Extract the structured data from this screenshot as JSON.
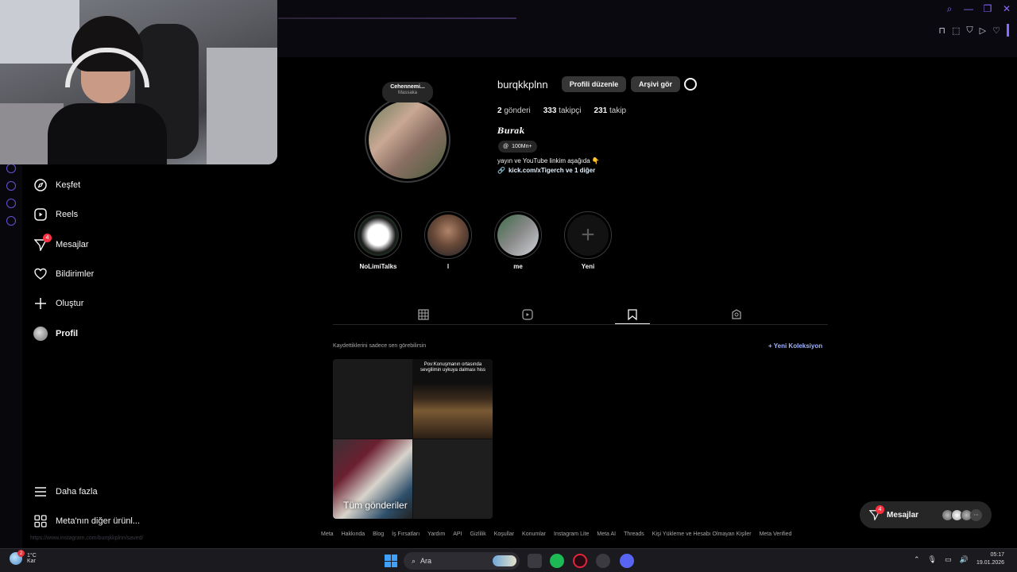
{
  "colors": {
    "bg": "#000000",
    "accent_gx": "#8a6bff",
    "badge": "#ff3040",
    "link": "#a0b4ff"
  },
  "nav": {
    "items": [
      {
        "label": "Keşfet",
        "icon": "compass-icon"
      },
      {
        "label": "Reels",
        "icon": "reels-icon"
      },
      {
        "label": "Mesajlar",
        "icon": "messenger-icon",
        "badge": "4"
      },
      {
        "label": "Bildirimler",
        "icon": "heart-icon"
      },
      {
        "label": "Oluştur",
        "icon": "plus-icon"
      },
      {
        "label": "Profil",
        "icon": "avatar"
      }
    ],
    "more": "Daha fazla",
    "meta": "Meta'nın diğer ürünl..."
  },
  "note": {
    "title": "Cehennemi...",
    "subtitle": "Massaka"
  },
  "profile": {
    "username": "burqkkplnn",
    "edit_btn": "Profili düzenle",
    "archive_btn": "Arşivi gör",
    "posts_count": "2",
    "posts_label": "gönderi",
    "followers_count": "333",
    "followers_label": "takipçi",
    "following_count": "231",
    "following_label": "takip",
    "full_name": "Burak",
    "threads_chip": "100Mn+",
    "bio": "yayın ve YouTube linkim aşağıda 👇",
    "link": "kick.com/xTigerch ve 1 diğer"
  },
  "highlights": [
    {
      "label": "NoLimiTalks"
    },
    {
      "label": "l"
    },
    {
      "label": "me"
    },
    {
      "label": "Yeni"
    }
  ],
  "saved": {
    "note": "Kaydettiklerini sadece sen görebilirsin",
    "new_collection": "+ Yeni Koleksiyon",
    "collection_title": "Tüm gönderiler",
    "caption": "Pov:Konuşmanın ortasında sevgilimin uykuya dalması hiss"
  },
  "footer": [
    "Meta",
    "Hakkında",
    "Blog",
    "İş Fırsatları",
    "Yardım",
    "API",
    "Gizlilik",
    "Koşullar",
    "Konumlar",
    "Instagram Lite",
    "Meta AI",
    "Threads",
    "Kişi Yükleme ve Hesabı Olmayan Kişiler",
    "Meta Verified"
  ],
  "messages_bubble": {
    "label": "Mesajlar",
    "badge": "4"
  },
  "taskbar": {
    "weather_temp": "1°C",
    "weather_desc": "Kar",
    "weather_badge": "2",
    "search_label": "Ara",
    "time": "05:17",
    "date": "19.01.2026"
  },
  "url_hint": "https://www.instagram.com/burqkkplnn/saved/"
}
